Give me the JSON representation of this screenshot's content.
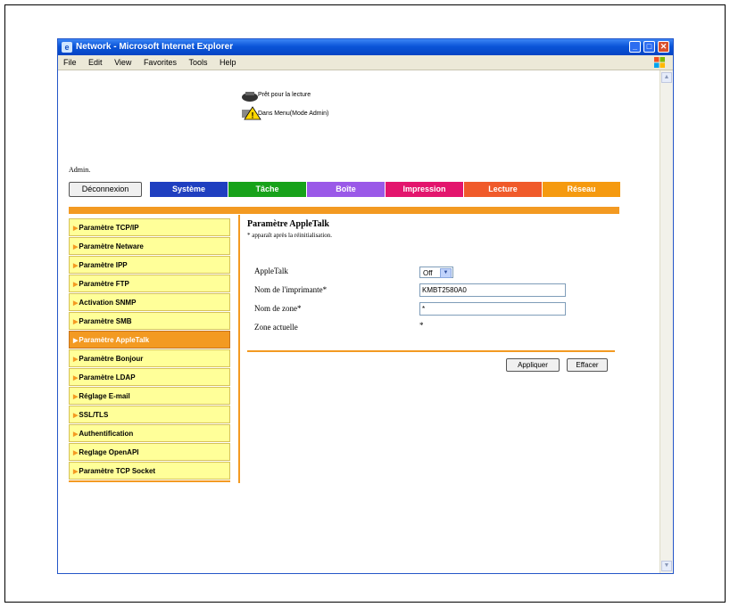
{
  "window": {
    "title": "Network - Microsoft Internet Explorer",
    "menu": [
      "File",
      "Edit",
      "View",
      "Favorites",
      "Tools",
      "Help"
    ]
  },
  "status": {
    "ready": "Prêt pour la lecture",
    "admin_mode": "Dans Menu(Mode Admin)"
  },
  "user": "Admin.",
  "logout_label": "Déconnexion",
  "tabs": [
    {
      "label": "Système",
      "color": "#1f3fc0"
    },
    {
      "label": "Tâche",
      "color": "#17a21a"
    },
    {
      "label": "Boîte",
      "color": "#9a59e8"
    },
    {
      "label": "Impression",
      "color": "#e3156d"
    },
    {
      "label": "Lecture",
      "color": "#f05a2a"
    },
    {
      "label": "Réseau",
      "color": "#f59a10"
    }
  ],
  "sidebar": [
    {
      "label": "Paramètre TCP/IP"
    },
    {
      "label": "Paramètre Netware"
    },
    {
      "label": "Paramètre IPP"
    },
    {
      "label": "Paramètre FTP"
    },
    {
      "label": "Activation SNMP"
    },
    {
      "label": "Paramètre SMB"
    },
    {
      "label": "Paramètre AppleTalk",
      "active": true
    },
    {
      "label": "Paramètre Bonjour"
    },
    {
      "label": "Paramètre LDAP"
    },
    {
      "label": "Réglage E-mail"
    },
    {
      "label": "SSL/TLS"
    },
    {
      "label": "Authentification"
    },
    {
      "label": "Reglage OpenAPI"
    },
    {
      "label": "Paramètre TCP Socket"
    }
  ],
  "main": {
    "title": "Paramètre AppleTalk",
    "note": "* apparaît après la réinitialisation.",
    "appletalk_label": "AppleTalk",
    "appletalk_value": "Off",
    "printer_name_label": "Nom de l'imprimante*",
    "printer_name_value": "KMBT2580A0",
    "zone_label": "Nom de zone*",
    "zone_value": "*",
    "current_zone_label": "Zone actuelle",
    "current_zone_value": "*",
    "apply_label": "Appliquer",
    "clear_label": "Effacer"
  },
  "colors": {
    "accent": "#f39a22",
    "sidebar_bg": "#ffff99"
  }
}
